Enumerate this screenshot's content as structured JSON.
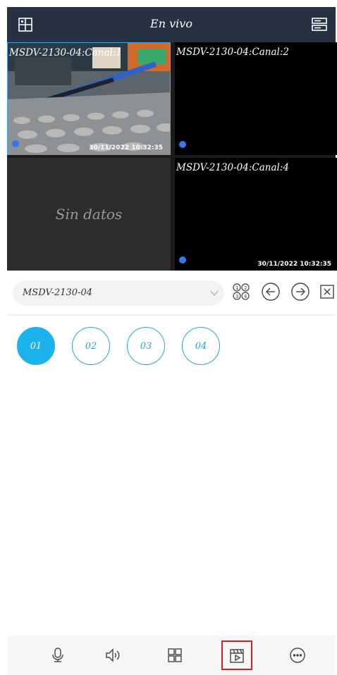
{
  "header": {
    "title": "En vivo",
    "left_icon": "layout-grid-icon",
    "right_icon": "device-list-icon"
  },
  "cameras": [
    {
      "label": "MSDV-2130-04:Canal:1",
      "timestamp": "30/11/2022 10:32:35",
      "selected": true
    },
    {
      "label": "MSDV-2130-04:Canal:2",
      "timestamp": ""
    },
    {
      "label": "",
      "no_data_text": "Sin datos"
    },
    {
      "label": "MSDV-2130-04:Canal:4",
      "timestamp": "30/11/2022 10:32:35"
    }
  ],
  "device": {
    "selected": "MSDV-2130-04",
    "chevron_icon": "chevron-down-icon",
    "controls": [
      "channel-layout-icon",
      "previous-arrow-icon",
      "next-arrow-icon",
      "close-all-icon"
    ]
  },
  "channels": [
    "01",
    "02",
    "03",
    "04"
  ],
  "active_channel": "01",
  "bottom_bar": {
    "icons": [
      "microphone-icon",
      "speaker-icon",
      "grid-view-icon",
      "playback-icon",
      "more-icon"
    ],
    "highlighted": "playback-icon"
  },
  "colors": {
    "header_bg": "#283142",
    "accent": "#1cb2ec",
    "channel_outline": "#2aa6d5",
    "status_dot": "#2f7af0",
    "highlight_border": "#d32222"
  }
}
